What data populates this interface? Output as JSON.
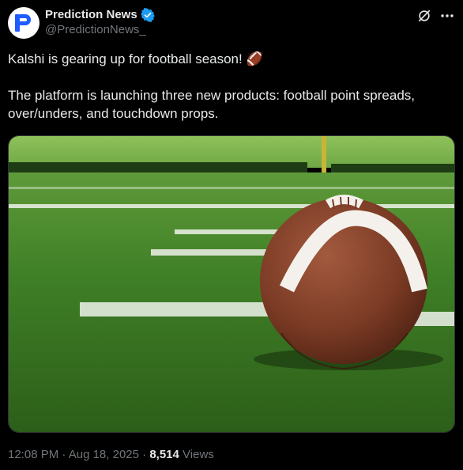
{
  "author": {
    "display_name": "Prediction News",
    "handle": "@PredictionNews_",
    "avatar_letter": "P",
    "verified": true
  },
  "post": {
    "line1": "Kalshi is gearing up for football season! 🏈",
    "line2": "The platform is launching three new products: football point spreads, over/unders, and touchdown props."
  },
  "media": {
    "subject": "american-football-on-field"
  },
  "meta": {
    "time": "12:08 PM",
    "date": "Aug 18, 2025",
    "views_count": "8,514",
    "views_label": "Views"
  },
  "colors": {
    "accent": "#1d9bf0",
    "brand": "#1d5cff",
    "background": "#000000",
    "muted": "#71767b"
  },
  "icons": [
    "verified-badge-icon",
    "grok-icon",
    "more-icon"
  ]
}
